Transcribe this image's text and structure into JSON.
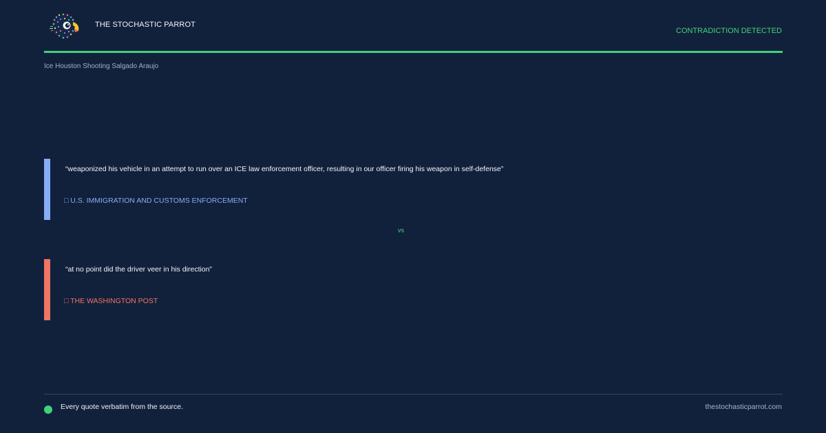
{
  "brand": {
    "name": "THE STOCHASTIC PARROT",
    "logo_icon": "parrot-logo-icon"
  },
  "header": {
    "status": "CONTRADICTION DETECTED",
    "topic": "Ice Houston Shooting Salgado Araujo"
  },
  "quotes": [
    {
      "text": "“weaponized his vehicle in an attempt to run over an ICE law enforcement officer, resulting in our officer firing his weapon in self-defense”",
      "source": "□ U.S. IMMIGRATION AND CUSTOMS ENFORCEMENT",
      "accent": "#86adf6"
    },
    {
      "text": "“at no point did the driver veer in his direction”",
      "source": "□ THE WASHINGTON POST",
      "accent": "#f07563"
    }
  ],
  "separator": "vs",
  "footer": {
    "note": "Every quote verbatim from the source.",
    "site": "thestochasticparrot.com"
  },
  "colors": {
    "background": "#12213b",
    "accent_green": "#3fd47b",
    "quote_blue": "#86adf6",
    "quote_red": "#f07563"
  }
}
